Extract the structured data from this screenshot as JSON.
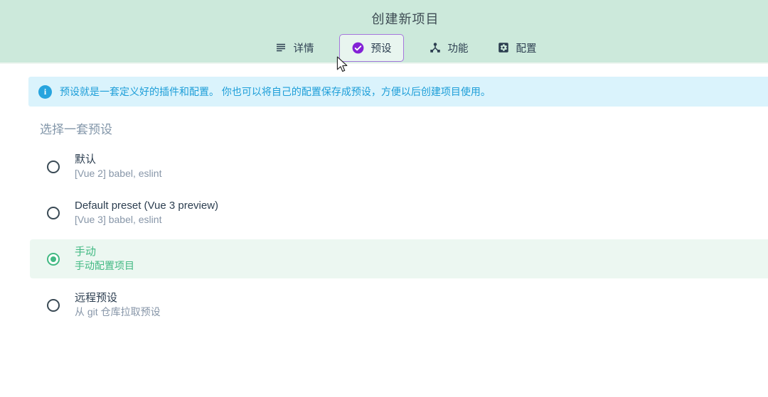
{
  "header": {
    "title": "创建新项目",
    "tabs": [
      {
        "label": "详情",
        "icon": "list-icon",
        "active": false
      },
      {
        "label": "预设",
        "icon": "check-circle-icon",
        "active": true
      },
      {
        "label": "功能",
        "icon": "hub-icon",
        "active": false
      },
      {
        "label": "配置",
        "icon": "settings-icon",
        "active": false
      }
    ]
  },
  "banner": {
    "icon": "info-icon",
    "icon_glyph": "i",
    "text": "预设就是一套定义好的插件和配置。 你也可以将自己的配置保存成预设，方便以后创建项目使用。"
  },
  "section": {
    "heading": "选择一套预设"
  },
  "presets": [
    {
      "name": "默认",
      "description": "[Vue 2] babel, eslint",
      "selected": false
    },
    {
      "name": "Default preset (Vue 3 preview)",
      "description": "[Vue 3] babel, eslint",
      "selected": false
    },
    {
      "name": "手动",
      "description": "手动配置项目",
      "selected": true
    },
    {
      "name": "远程预设",
      "description": "从 git 仓库拉取预设",
      "selected": false
    }
  ],
  "colors": {
    "header_background": "#cce9db",
    "accent_purple": "#8322d6",
    "active_tab_border": "#a677dc",
    "banner_background": "#daf3fc",
    "banner_text": "#1d9ed8",
    "info_icon_background": "#27a4de",
    "vue_green": "#42b983",
    "selected_row_background": "#ecf7f1",
    "text_dark": "#2c3e50",
    "text_secondary": "#8796a8"
  }
}
